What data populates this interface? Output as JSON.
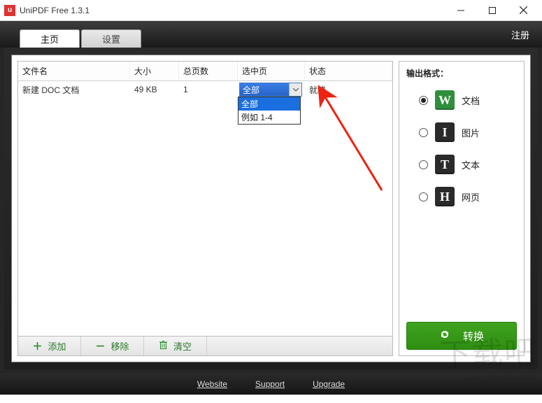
{
  "window": {
    "title": "UniPDF Free 1.3.1",
    "app_icon_letter": "u"
  },
  "tabs": {
    "home": "主页",
    "settings": "设置"
  },
  "register_link": "注册",
  "grid": {
    "headers": {
      "filename": "文件名",
      "size": "大小",
      "total_pages": "总页数",
      "selected_pages": "选中页",
      "status": "状态"
    },
    "rows": [
      {
        "filename": "新建 DOC 文档",
        "size": "49 KB",
        "total_pages": "1",
        "selected_pages_value": "全部",
        "status": "就绪"
      }
    ],
    "dropdown_options": {
      "all": "全部",
      "example": "例如 1-4"
    }
  },
  "toolbar": {
    "add": "添加",
    "remove": "移除",
    "clear": "清空"
  },
  "output": {
    "heading": "输出格式：",
    "formats": {
      "doc": {
        "letter": "W",
        "label": "文档"
      },
      "image": {
        "letter": "I",
        "label": "图片"
      },
      "text": {
        "letter": "T",
        "label": "文本"
      },
      "html": {
        "letter": "H",
        "label": "网页"
      }
    },
    "convert": "转换"
  },
  "footer": {
    "website": "Website",
    "support": "Support",
    "upgrade": "Upgrade"
  },
  "watermark": {
    "text": "下载吧",
    "url": "www.xiazaiba.com"
  }
}
